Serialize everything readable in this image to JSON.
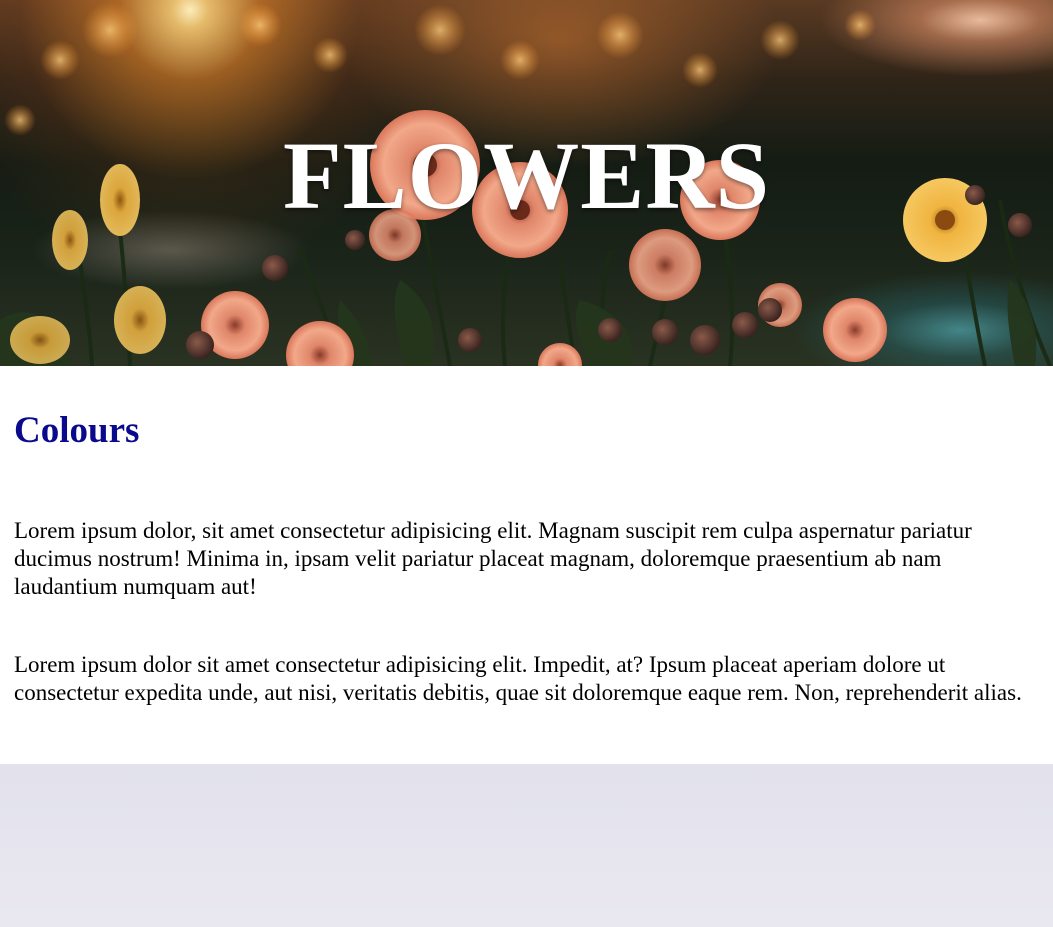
{
  "hero": {
    "title": "FLOWERS"
  },
  "section": {
    "heading": "Colours",
    "paragraphs": [
      "Lorem ipsum dolor, sit amet consectetur adipisicing elit. Magnam suscipit rem culpa aspernatur pariatur ducimus nostrum! Minima in, ipsam velit pariatur placeat magnam, doloremque praesentium ab nam laudantium numquam aut!",
      "Lorem ipsum dolor sit amet consectetur adipisicing elit. Impedit, at? Ipsum placeat aperiam dolore ut consectetur expedita unde, aut nisi, veritatis debitis, quae sit doloremque eaque rem. Non, reprehenderit alias."
    ]
  },
  "colors": {
    "heading": "#0a0a8c",
    "hero_title": "#ffffff",
    "content_bg": "#ffffff",
    "page_bg": "#e5e4ee"
  }
}
